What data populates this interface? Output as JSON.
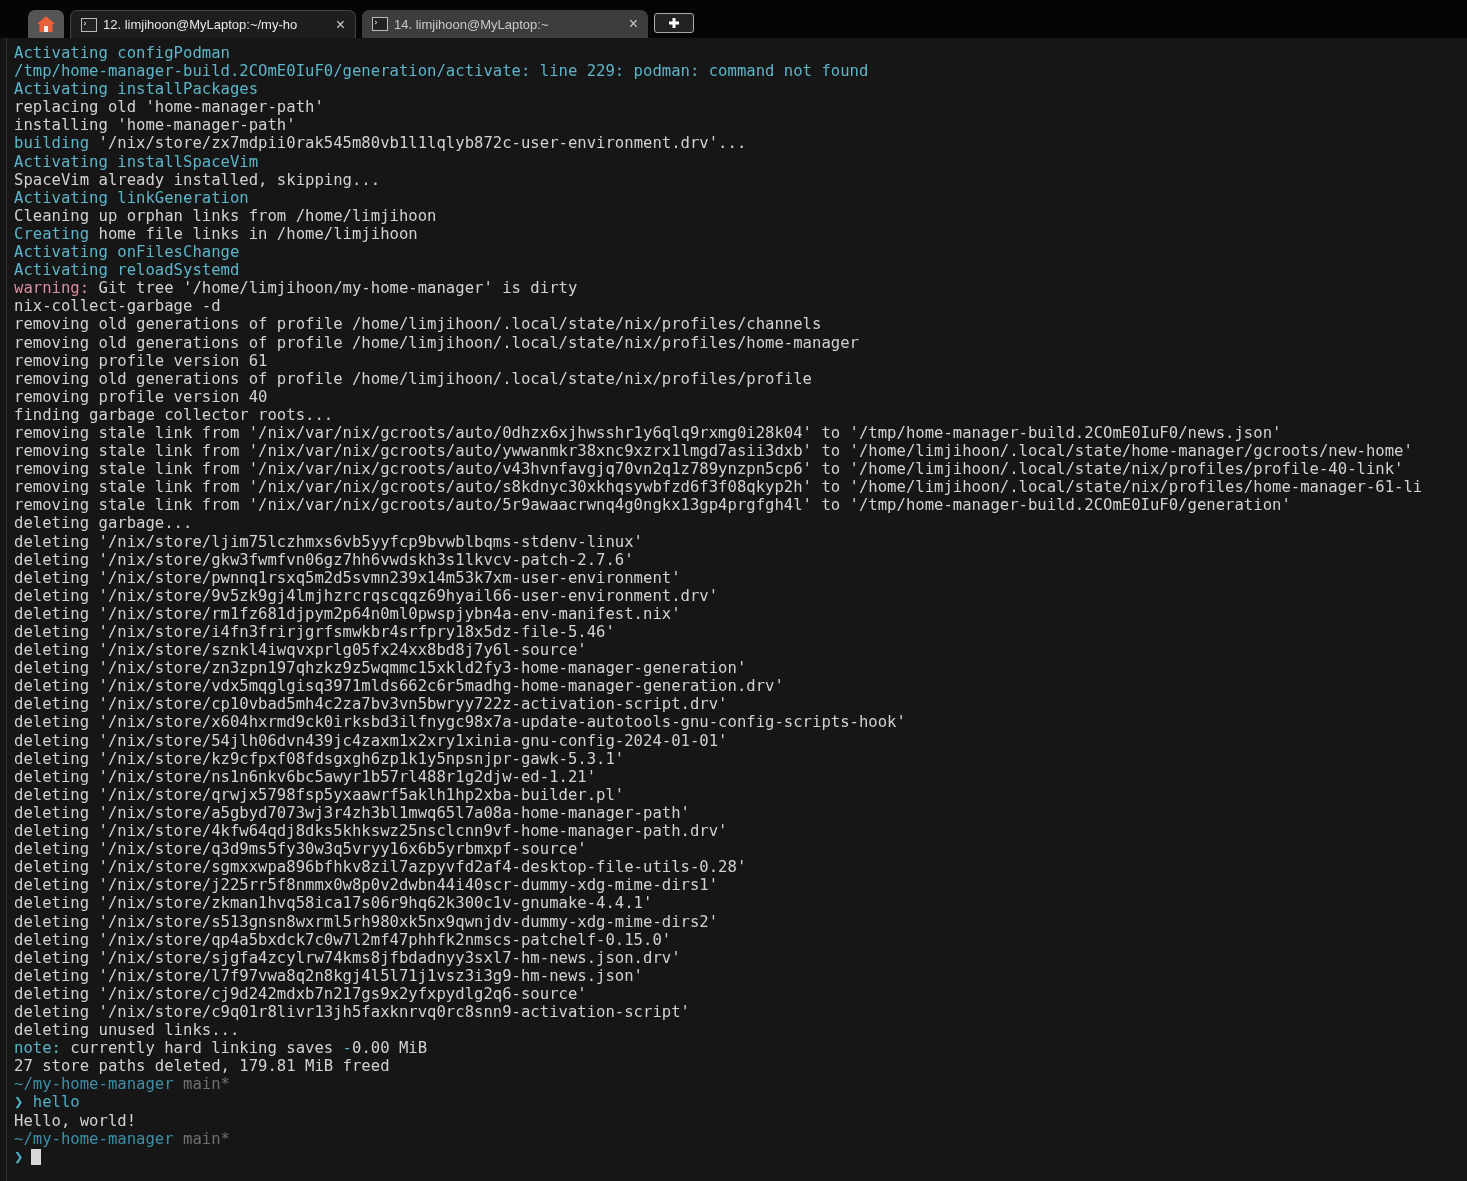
{
  "tabs": [
    {
      "kind": "home",
      "selected": false
    },
    {
      "kind": "terminal",
      "label": "12. limjihoon@MyLaptop:~/my-ho",
      "close": "×",
      "selected": true
    },
    {
      "kind": "terminal",
      "label": "14. limjihoon@MyLaptop:~",
      "close": "×",
      "selected": false
    }
  ],
  "lines": [
    {
      "segments": [
        {
          "kind": "info",
          "text": "Activating configPodman"
        }
      ]
    },
    {
      "segments": [
        {
          "kind": "info",
          "text": "/tmp/home-manager-build.2COmE0IuF0/generation/activate: line 229: podman: command not found"
        }
      ]
    },
    {
      "segments": [
        {
          "kind": "info",
          "text": "Activating installPackages"
        }
      ]
    },
    {
      "segments": [
        {
          "kind": "plain",
          "text": "replacing old 'home-manager-path'"
        }
      ]
    },
    {
      "segments": [
        {
          "kind": "plain",
          "text": "installing 'home-manager-path'"
        }
      ]
    },
    {
      "segments": [
        {
          "kind": "info",
          "text": "building"
        },
        {
          "kind": "plain",
          "text": " '/nix/store/zx7mdpii0rak545m80vb1l1lqlyb872c-user-environment.drv'..."
        }
      ]
    },
    {
      "segments": [
        {
          "kind": "info",
          "text": "Activating installSpaceVim"
        }
      ]
    },
    {
      "segments": [
        {
          "kind": "plain",
          "text": "SpaceVim already installed, skipping..."
        }
      ]
    },
    {
      "segments": [
        {
          "kind": "info",
          "text": "Activating linkGeneration"
        }
      ]
    },
    {
      "segments": [
        {
          "kind": "plain",
          "text": "Cleaning up orphan links from /home/limjihoon"
        }
      ]
    },
    {
      "segments": [
        {
          "kind": "info",
          "text": "Creating"
        },
        {
          "kind": "plain",
          "text": " home file links in /home/limjihoon"
        }
      ]
    },
    {
      "segments": [
        {
          "kind": "info",
          "text": "Activating onFilesChange"
        }
      ]
    },
    {
      "segments": [
        {
          "kind": "info",
          "text": "Activating reloadSystemd"
        }
      ]
    },
    {
      "segments": [
        {
          "kind": "warn",
          "text": "warning:"
        },
        {
          "kind": "plain",
          "text": " Git tree '/home/limjihoon/my-home-manager' is dirty"
        }
      ]
    },
    {
      "segments": [
        {
          "kind": "plain",
          "text": "nix-collect-garbage -d"
        }
      ]
    },
    {
      "segments": [
        {
          "kind": "plain",
          "text": "removing old generations of profile /home/limjihoon/.local/state/nix/profiles/channels"
        }
      ]
    },
    {
      "segments": [
        {
          "kind": "plain",
          "text": "removing old generations of profile /home/limjihoon/.local/state/nix/profiles/home-manager"
        }
      ]
    },
    {
      "segments": [
        {
          "kind": "plain",
          "text": "removing profile version 61"
        }
      ]
    },
    {
      "segments": [
        {
          "kind": "plain",
          "text": "removing old generations of profile /home/limjihoon/.local/state/nix/profiles/profile"
        }
      ]
    },
    {
      "segments": [
        {
          "kind": "plain",
          "text": "removing profile version 40"
        }
      ]
    },
    {
      "segments": [
        {
          "kind": "plain",
          "text": "finding garbage collector roots..."
        }
      ]
    },
    {
      "segments": [
        {
          "kind": "plain",
          "text": "removing stale link from '/nix/var/nix/gcroots/auto/0dhzx6xjhwsshr1y6qlq9rxmg0i28k04' to '/tmp/home-manager-build.2COmE0IuF0/news.json'"
        }
      ]
    },
    {
      "segments": [
        {
          "kind": "plain",
          "text": "removing stale link from '/nix/var/nix/gcroots/auto/ywwanmkr38xnc9xzrx1lmgd7asii3dxb' to '/home/limjihoon/.local/state/home-manager/gcroots/new-home'"
        }
      ]
    },
    {
      "segments": [
        {
          "kind": "plain",
          "text": "removing stale link from '/nix/var/nix/gcroots/auto/v43hvnfavgjq70vn2q1z789ynzpn5cp6' to '/home/limjihoon/.local/state/nix/profiles/profile-40-link'"
        }
      ]
    },
    {
      "segments": [
        {
          "kind": "plain",
          "text": "removing stale link from '/nix/var/nix/gcroots/auto/s8kdnyc30xkhqsywbfzd6f3f08qkyp2h' to '/home/limjihoon/.local/state/nix/profiles/home-manager-61-li"
        }
      ]
    },
    {
      "segments": [
        {
          "kind": "plain",
          "text": "removing stale link from '/nix/var/nix/gcroots/auto/5r9awaacrwnq4g0ngkx13gp4prgfgh4l' to '/tmp/home-manager-build.2COmE0IuF0/generation'"
        }
      ]
    },
    {
      "segments": [
        {
          "kind": "plain",
          "text": "deleting garbage..."
        }
      ]
    },
    {
      "segments": [
        {
          "kind": "plain",
          "text": "deleting '/nix/store/ljim75lczhmxs6vb5yyfcp9bvwblbqms-stdenv-linux'"
        }
      ]
    },
    {
      "segments": [
        {
          "kind": "plain",
          "text": "deleting '/nix/store/gkw3fwmfvn06gz7hh6vwdskh3s1lkvcv-patch-2.7.6'"
        }
      ]
    },
    {
      "segments": [
        {
          "kind": "plain",
          "text": "deleting '/nix/store/pwnnq1rsxq5m2d5svmn239x14m53k7xm-user-environment'"
        }
      ]
    },
    {
      "segments": [
        {
          "kind": "plain",
          "text": "deleting '/nix/store/9v5zk9gj4lmjhzrcrqscqqz69hyail66-user-environment.drv'"
        }
      ]
    },
    {
      "segments": [
        {
          "kind": "plain",
          "text": "deleting '/nix/store/rm1fz681djpym2p64n0ml0pwspjybn4a-env-manifest.nix'"
        }
      ]
    },
    {
      "segments": [
        {
          "kind": "plain",
          "text": "deleting '/nix/store/i4fn3frirjgrfsmwkbr4srfpry18x5dz-file-5.46'"
        }
      ]
    },
    {
      "segments": [
        {
          "kind": "plain",
          "text": "deleting '/nix/store/sznkl4iwqvxprlg05fx24xx8bd8j7y6l-source'"
        }
      ]
    },
    {
      "segments": [
        {
          "kind": "plain",
          "text": "deleting '/nix/store/zn3zpn197qhzkz9z5wqmmc15xkld2fy3-home-manager-generation'"
        }
      ]
    },
    {
      "segments": [
        {
          "kind": "plain",
          "text": "deleting '/nix/store/vdx5mqglgisq3971mlds662c6r5madhg-home-manager-generation.drv'"
        }
      ]
    },
    {
      "segments": [
        {
          "kind": "plain",
          "text": "deleting '/nix/store/cp10vbad5mh4c2za7bv3vn5bwryy722z-activation-script.drv'"
        }
      ]
    },
    {
      "segments": [
        {
          "kind": "plain",
          "text": "deleting '/nix/store/x604hxrmd9ck0irksbd3ilfnygc98x7a-update-autotools-gnu-config-scripts-hook'"
        }
      ]
    },
    {
      "segments": [
        {
          "kind": "plain",
          "text": "deleting '/nix/store/54jlh06dvn439jc4zaxm1x2xry1xinia-gnu-config-2024-01-01'"
        }
      ]
    },
    {
      "segments": [
        {
          "kind": "plain",
          "text": "deleting '/nix/store/kz9cfpxf08fdsgxgh6zp1k1y5npsnjpr-gawk-5.3.1'"
        }
      ]
    },
    {
      "segments": [
        {
          "kind": "plain",
          "text": "deleting '/nix/store/ns1n6nkv6bc5awyr1b57rl488r1g2djw-ed-1.21'"
        }
      ]
    },
    {
      "segments": [
        {
          "kind": "plain",
          "text": "deleting '/nix/store/qrwjx5798fsp5yxaawrf5aklh1hp2xba-builder.pl'"
        }
      ]
    },
    {
      "segments": [
        {
          "kind": "plain",
          "text": "deleting '/nix/store/a5gbyd7073wj3r4zh3bl1mwq65l7a08a-home-manager-path'"
        }
      ]
    },
    {
      "segments": [
        {
          "kind": "plain",
          "text": "deleting '/nix/store/4kfw64qdj8dks5khkswz25nsclcnn9vf-home-manager-path.drv'"
        }
      ]
    },
    {
      "segments": [
        {
          "kind": "plain",
          "text": "deleting '/nix/store/q3d9ms5fy30w3q5vryy16x6b5yrbmxpf-source'"
        }
      ]
    },
    {
      "segments": [
        {
          "kind": "plain",
          "text": "deleting '/nix/store/sgmxxwpa896bfhkv8zil7azpyvfd2af4-desktop-file-utils-0.28'"
        }
      ]
    },
    {
      "segments": [
        {
          "kind": "plain",
          "text": "deleting '/nix/store/j225rr5f8nmmx0w8p0v2dwbn44i40scr-dummy-xdg-mime-dirs1'"
        }
      ]
    },
    {
      "segments": [
        {
          "kind": "plain",
          "text": "deleting '/nix/store/zkman1hvq58ica17s06r9hq62k300c1v-gnumake-4.4.1'"
        }
      ]
    },
    {
      "segments": [
        {
          "kind": "plain",
          "text": "deleting '/nix/store/s513gnsn8wxrml5rh980xk5nx9qwnjdv-dummy-xdg-mime-dirs2'"
        }
      ]
    },
    {
      "segments": [
        {
          "kind": "plain",
          "text": "deleting '/nix/store/qp4a5bxdck7c0w7l2mf47phhfk2nmscs-patchelf-0.15.0'"
        }
      ]
    },
    {
      "segments": [
        {
          "kind": "plain",
          "text": "deleting '/nix/store/sjgfa4zcylrw74kms8jfbdadnyy3sxl7-hm-news.json.drv'"
        }
      ]
    },
    {
      "segments": [
        {
          "kind": "plain",
          "text": "deleting '/nix/store/l7f97vwa8q2n8kgj4l5l71j1vsz3i3g9-hm-news.json'"
        }
      ]
    },
    {
      "segments": [
        {
          "kind": "plain",
          "text": "deleting '/nix/store/cj9d242mdxb7n217gs9x2yfxpydlg2q6-source'"
        }
      ]
    },
    {
      "segments": [
        {
          "kind": "plain",
          "text": "deleting '/nix/store/c9q01r8livr13jh5faxknrvq0rc8snn9-activation-script'"
        }
      ]
    },
    {
      "segments": [
        {
          "kind": "plain",
          "text": "deleting unused links..."
        }
      ]
    },
    {
      "segments": [
        {
          "kind": "info",
          "text": "note:"
        },
        {
          "kind": "plain",
          "text": " currently hard linking saves "
        },
        {
          "kind": "info",
          "text": "-"
        },
        {
          "kind": "plain",
          "text": "0.00 MiB"
        }
      ]
    },
    {
      "segments": [
        {
          "kind": "plain",
          "text": "27 store paths deleted, 179.81 MiB freed"
        }
      ]
    },
    {
      "segments": [
        {
          "kind": "path",
          "text": "~/my-home-manager"
        },
        {
          "kind": "branch",
          "text": " main*"
        }
      ]
    },
    {
      "segments": [
        {
          "kind": "prompt",
          "text": "❯ hello"
        }
      ]
    },
    {
      "segments": [
        {
          "kind": "plain",
          "text": "Hello, world!"
        }
      ]
    },
    {
      "segments": [
        {
          "kind": "path",
          "text": "~/my-home-manager"
        },
        {
          "kind": "branch",
          "text": " main*"
        }
      ]
    },
    {
      "segments": [
        {
          "kind": "prompt",
          "text": "❯"
        }
      ],
      "cursor": true
    }
  ]
}
